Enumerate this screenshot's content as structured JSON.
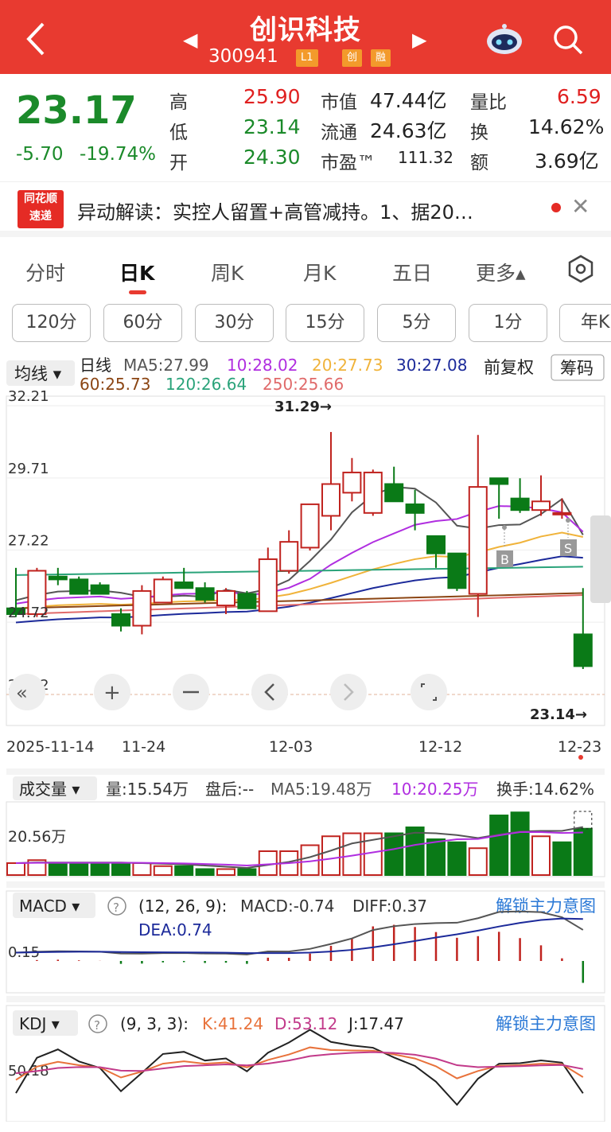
{
  "header": {
    "title": "创识科技",
    "code": "300941",
    "tags": [
      "L1",
      "创",
      "融"
    ]
  },
  "quote": {
    "price": "23.17",
    "change": "-5.70",
    "change_pct": "-19.74%",
    "high_label": "高",
    "high": "25.90",
    "low_label": "低",
    "low": "23.14",
    "open_label": "开",
    "open": "24.30",
    "mcap_label": "市值",
    "mcap": "47.44亿",
    "float_label": "流通",
    "float": "24.63亿",
    "pe_label": "市盈™",
    "pe": "111.32",
    "vr_label": "量比",
    "vr": "6.59",
    "turn_label": "换",
    "turn": "14.62%",
    "amt_label": "额",
    "amt": "3.69亿"
  },
  "news": {
    "logo_top": "同花顺",
    "logo_bottom": "速递",
    "text": "异动解读：实控人留置+高管减持。1、据20…"
  },
  "tabs": [
    "分时",
    "日K",
    "周K",
    "月K",
    "五日",
    "更多▴"
  ],
  "periods": [
    "120分",
    "60分",
    "30分",
    "15分",
    "5分",
    "1分",
    "年K"
  ],
  "main_chart": {
    "indicator_label": "均线 ▾",
    "line_label": "日线",
    "ma5": "MA5:27.99",
    "ma10": "10:28.02",
    "ma20": "20:27.73",
    "ma30": "30:27.08",
    "ma60": "60:25.73",
    "ma120": "120:26.64",
    "ma250": "250:25.66",
    "adjust": "前复权",
    "chip_button": "筹码",
    "y_labels": [
      "32.21",
      "29.71",
      "27.22",
      "24.72",
      "22.22"
    ],
    "max_marker": "31.29→",
    "min_marker": "23.14→",
    "x_labels": [
      "2025-11-14",
      "11-24",
      "12-03",
      "12-12",
      "12-23"
    ],
    "b_marker": "B",
    "s_marker": "S"
  },
  "volume_chart": {
    "label": "成交量 ▾",
    "vol": "量:15.54万",
    "after": "盘后:--",
    "ma5": "MA5:19.48万",
    "ma10": "10:20.25万",
    "turnover": "换手:14.62%",
    "y_label": "20.56万"
  },
  "macd_chart": {
    "label": "MACD ▾",
    "params": "(12, 26, 9):",
    "macd": "MACD:-0.74",
    "diff": "DIFF:0.37",
    "dea": "DEA:0.74",
    "unlock": "解锁主力意图",
    "y_label": "0.15"
  },
  "kdj_chart": {
    "label": "KDJ ▾",
    "params": "(9, 3, 3):",
    "k": "K:41.24",
    "d": "D:53.12",
    "j": "J:17.47",
    "unlock": "解锁主力意图",
    "y_label": "50.18"
  },
  "colors": {
    "up": "#c0231f",
    "down": "#0a7a17",
    "header": "#e83a30",
    "ma5": "#555555",
    "ma10": "#b02ee0",
    "ma20": "#f0b33a",
    "ma30": "#1c2a9a",
    "ma60": "#8b4513",
    "ma120": "#2aa37a",
    "ma250": "#e06a6a"
  },
  "chart_data": {
    "type": "candlestick",
    "dates_shown": [
      "2025-11-14",
      "11-24",
      "12-03",
      "12-12",
      "12-23"
    ],
    "ohlc": [
      [
        25.2,
        26.6,
        24.9,
        25.0
      ],
      [
        25.0,
        26.6,
        24.9,
        26.5
      ],
      [
        26.3,
        26.6,
        26.0,
        26.2
      ],
      [
        26.2,
        26.3,
        25.7,
        25.7
      ],
      [
        26.0,
        26.1,
        25.7,
        25.7
      ],
      [
        25.0,
        25.2,
        24.4,
        24.6
      ],
      [
        24.6,
        26.0,
        24.3,
        25.8
      ],
      [
        25.4,
        26.3,
        25.4,
        26.2
      ],
      [
        26.1,
        26.6,
        25.9,
        25.9
      ],
      [
        25.9,
        26.1,
        25.4,
        25.5
      ],
      [
        25.3,
        25.9,
        25.0,
        25.8
      ],
      [
        25.7,
        25.8,
        25.2,
        25.2
      ],
      [
        25.1,
        27.3,
        25.1,
        26.9
      ],
      [
        26.5,
        27.9,
        26.4,
        27.5
      ],
      [
        27.3,
        28.6,
        27.2,
        28.8
      ],
      [
        28.4,
        31.3,
        27.9,
        29.5
      ],
      [
        29.2,
        30.4,
        28.9,
        29.9
      ],
      [
        28.5,
        30.0,
        28.4,
        29.9
      ],
      [
        29.5,
        30.1,
        28.9,
        28.9
      ],
      [
        28.8,
        29.3,
        27.9,
        28.5
      ],
      [
        27.7,
        27.7,
        26.6,
        27.1
      ],
      [
        27.1,
        27.1,
        25.8,
        25.9
      ],
      [
        25.7,
        31.2,
        24.9,
        29.4
      ],
      [
        29.7,
        29.7,
        28.3,
        29.5
      ],
      [
        29.0,
        29.7,
        28.5,
        28.6
      ],
      [
        28.6,
        29.8,
        28.4,
        28.9
      ],
      [
        28.5,
        29.0,
        28.3,
        28.5
      ],
      [
        24.3,
        25.9,
        23.1,
        23.2
      ]
    ],
    "ylim": [
      22.22,
      32.21
    ],
    "volume": [
      4,
      5,
      4,
      4,
      4,
      4,
      4,
      3,
      3,
      2,
      2,
      2,
      8,
      8,
      10,
      13,
      14,
      14,
      14,
      16,
      12,
      11,
      9,
      20,
      21,
      13,
      11,
      15.54
    ],
    "volume_unit": "万",
    "volume_up": [
      true,
      true,
      false,
      false,
      false,
      false,
      true,
      true,
      false,
      false,
      true,
      false,
      true,
      true,
      true,
      true,
      true,
      true,
      false,
      false,
      false,
      false,
      true,
      false,
      false,
      true,
      false,
      false
    ]
  }
}
